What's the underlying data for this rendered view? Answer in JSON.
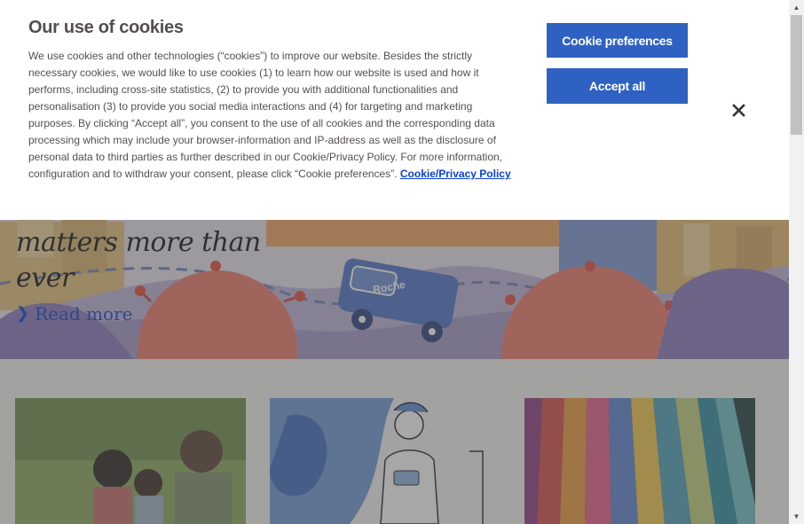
{
  "cookie_banner": {
    "title": "Our use of cookies",
    "body": "We use cookies and other technologies (“cookies”) to improve our website. Besides the strictly necessary cookies, we would like to use cookies (1) to learn how our website is used and how it performs, including cross-site statistics, (2) to provide you with additional functionalities and personalisation (3) to provide you social media interactions and (4) for targeting and marketing purposes. By clicking “Accept all”, you consent to the use of all cookies and the corresponding data processing which may include your browser-information and IP-address as well as the disclosure of personal data to third parties as further described in our Cookie/Privacy Policy. For more information, configuration and to withdraw your consent, please click “Cookie preferences”.",
    "policy_link": "Cookie/Privacy Policy",
    "preferences_label": "Cookie preferences",
    "accept_label": "Accept all",
    "close_icon": "close-icon"
  },
  "hero": {
    "title_line1": "matters more than",
    "title_line2": "ever",
    "read_more": "Read more",
    "van_label": "Roche"
  },
  "colors": {
    "button_blue": "#2e61c2",
    "link_blue": "#0b41cd",
    "text_gray": "#544f4f"
  }
}
